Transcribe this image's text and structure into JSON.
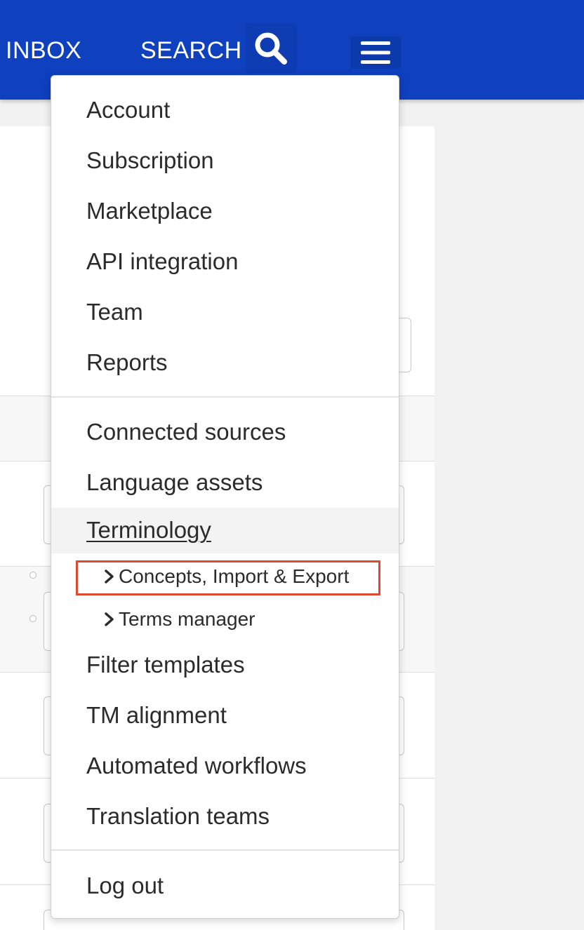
{
  "header": {
    "nav": {
      "inbox": "INBOX",
      "search": "SEARCH"
    },
    "search_icon": "search-icon",
    "menu_icon": "hamburger-menu-icon",
    "bg_color": "#0f40bd"
  },
  "menu": {
    "group1": [
      "Account",
      "Subscription",
      "Marketplace",
      "API integration",
      "Team",
      "Reports"
    ],
    "group2": {
      "connected_sources": "Connected sources",
      "language_assets": "Language assets",
      "terminology": "Terminology",
      "terminology_sub": [
        "Concepts, Import & Export",
        "Terms manager"
      ],
      "filter_templates": "Filter templates",
      "tm_alignment": "TM alignment",
      "automated_workflows": "Automated workflows",
      "translation_teams": "Translation teams"
    },
    "group3": {
      "logout": "Log out"
    },
    "highlight_color": "#dd4a31",
    "chevron_icon": "chevron-right-icon"
  }
}
